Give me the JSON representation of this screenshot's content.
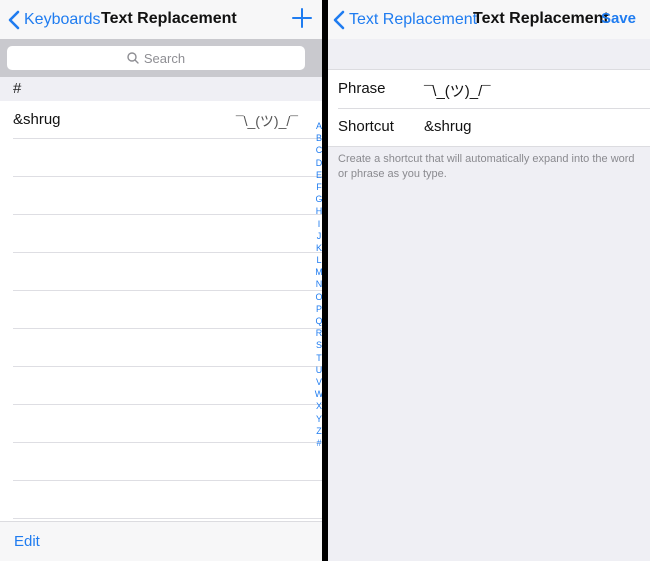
{
  "left_pane": {
    "nav": {
      "back_label": "Keyboards",
      "title": "Text Replacement"
    },
    "search": {
      "placeholder": "Search"
    },
    "section_header": "#",
    "entries": [
      {
        "shortcut": "&shrug",
        "phrase": "¯\\_(ツ)_/¯"
      }
    ],
    "index_letters": [
      "A",
      "B",
      "C",
      "D",
      "E",
      "F",
      "G",
      "H",
      "I",
      "J",
      "K",
      "L",
      "M",
      "N",
      "O",
      "P",
      "Q",
      "R",
      "S",
      "T",
      "U",
      "V",
      "W",
      "X",
      "Y",
      "Z",
      "#"
    ],
    "toolbar": {
      "edit_label": "Edit"
    }
  },
  "right_pane": {
    "nav": {
      "back_label": "Text Replacement",
      "title": "Text Replacement",
      "save_label": "Save"
    },
    "form": {
      "phrase_label": "Phrase",
      "phrase_value": "¯\\_(ツ)_/¯",
      "shortcut_label": "Shortcut",
      "shortcut_value": "&shrug"
    },
    "footnote": "Create a shortcut that will automatically expand into the word or phrase as you type."
  },
  "colors": {
    "accent": "#1f7cf0",
    "background_grouped": "#efeff4",
    "separator": "#dcdce0"
  }
}
